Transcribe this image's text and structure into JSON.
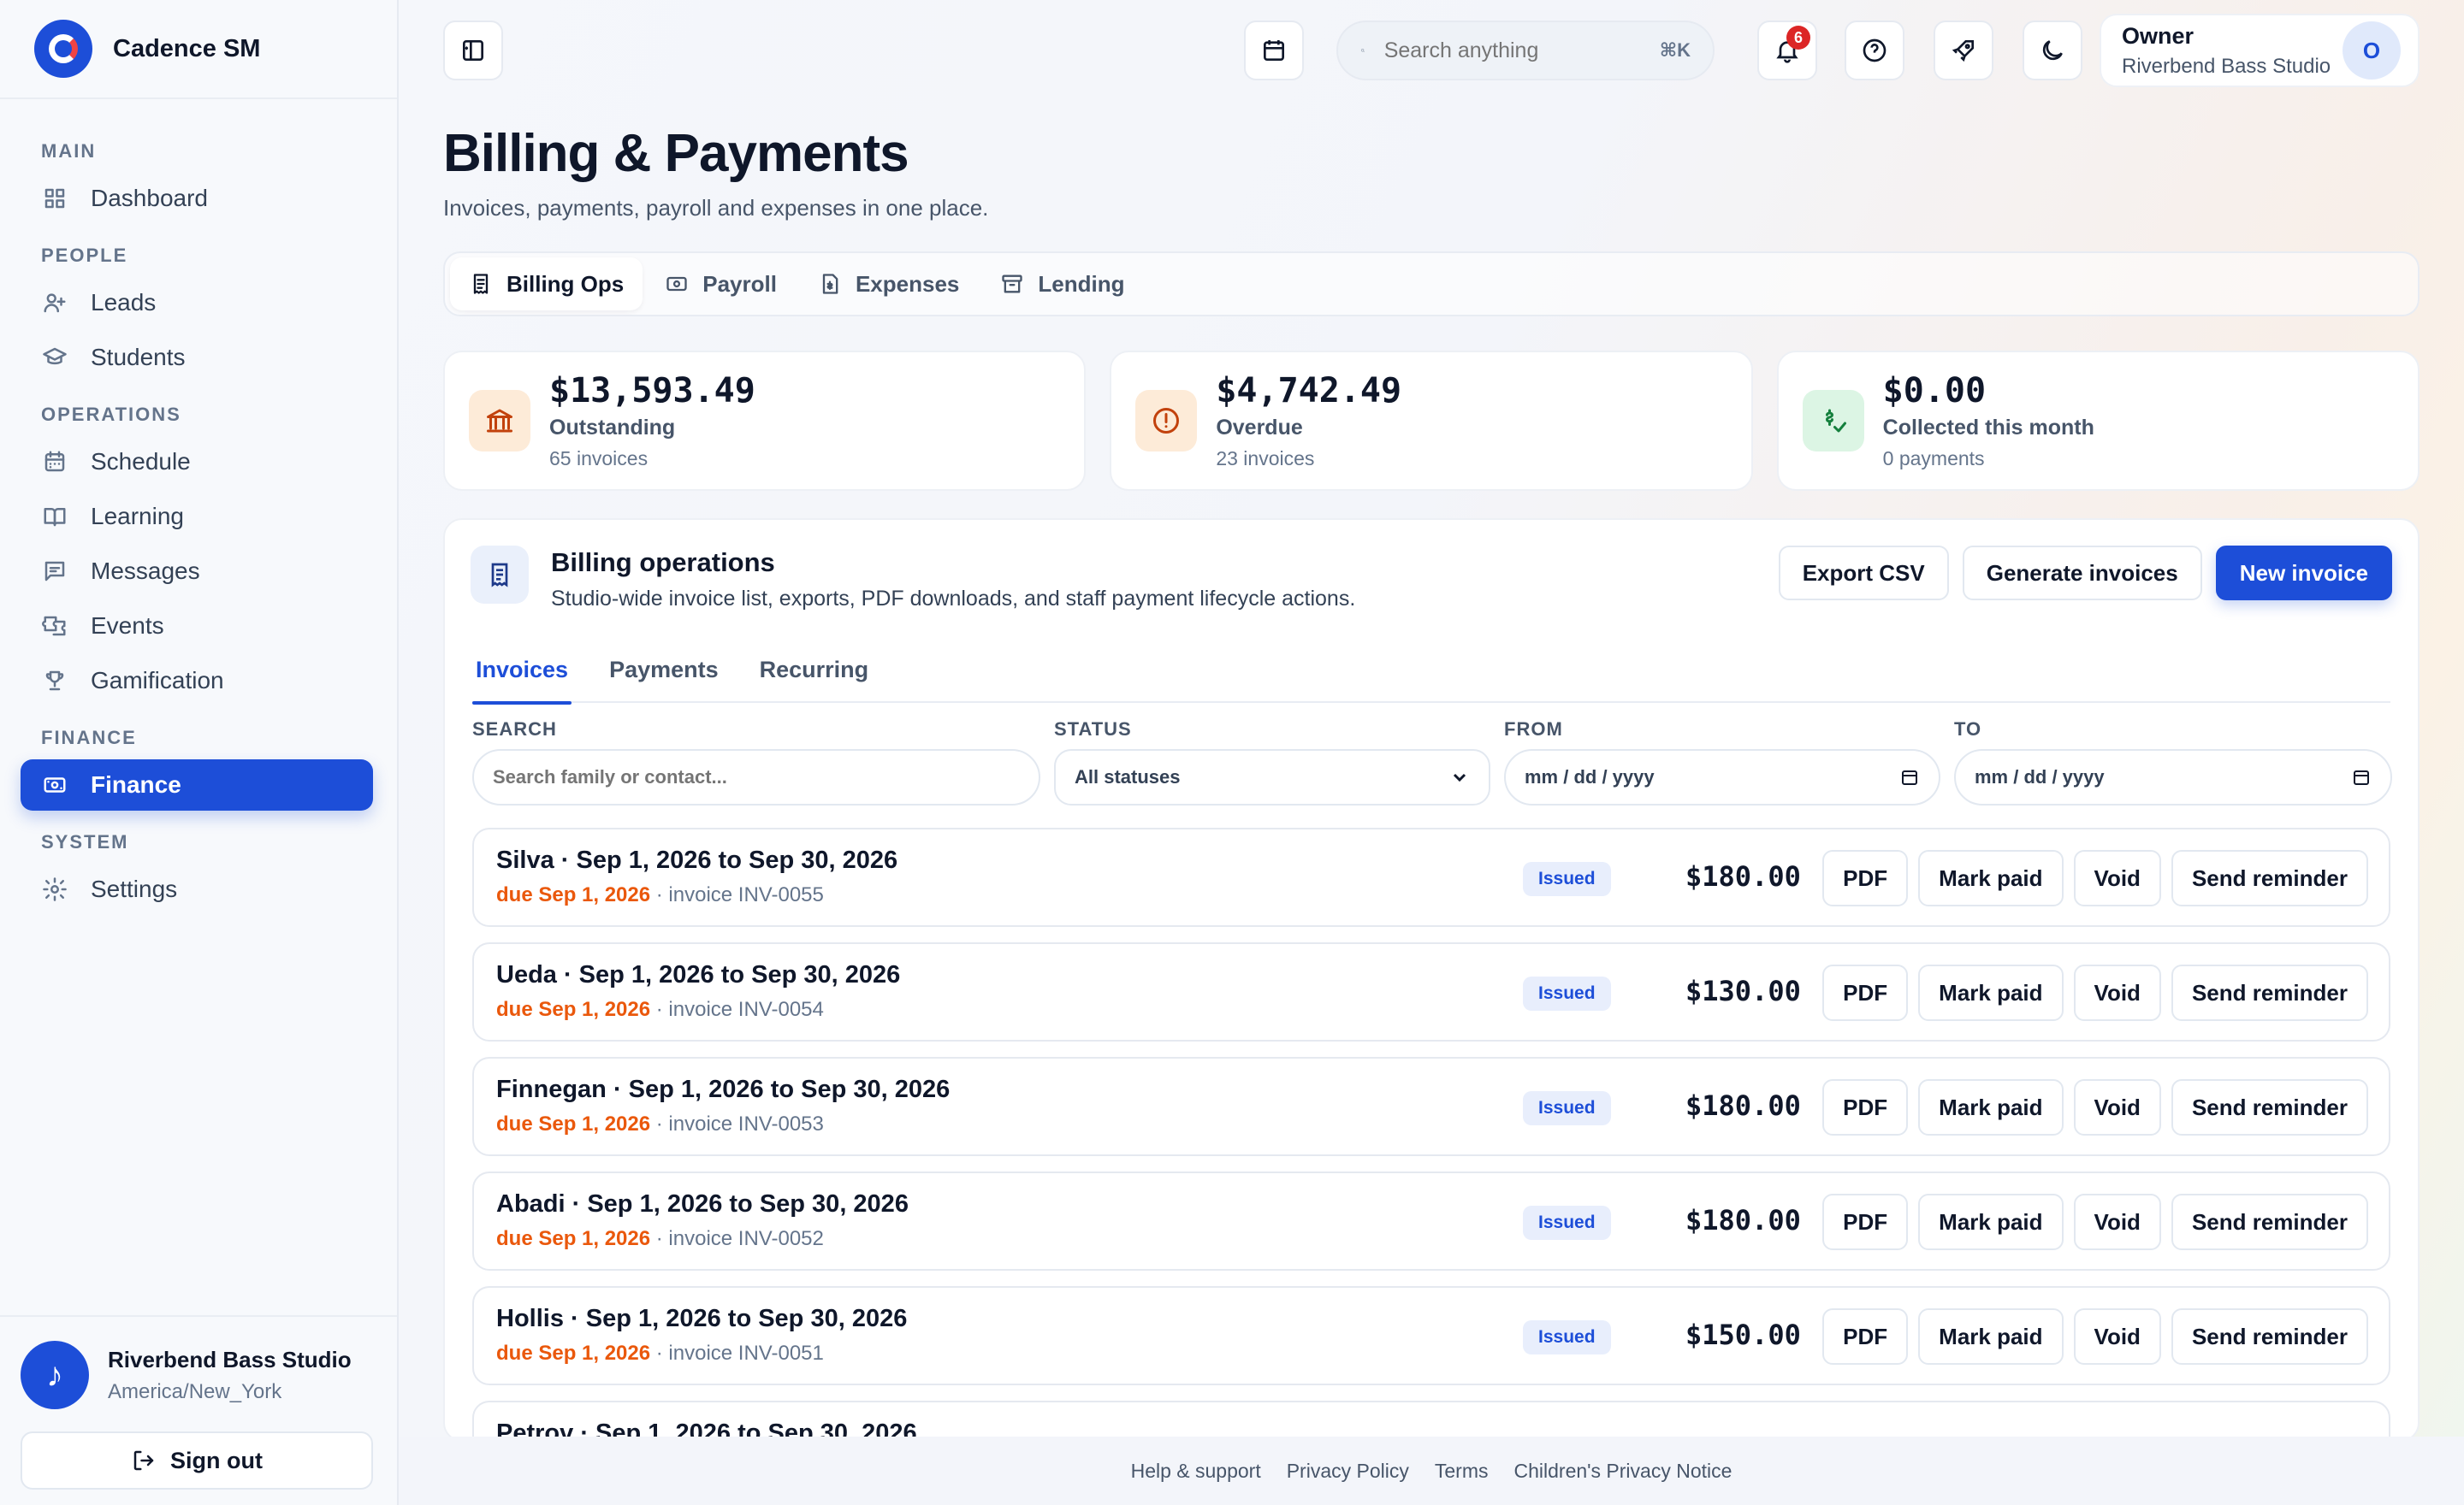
{
  "brand": {
    "name": "Cadence SM"
  },
  "sidebar": {
    "sections": [
      {
        "title": "MAIN",
        "items": [
          {
            "label": "Dashboard",
            "icon": "grid-icon"
          }
        ]
      },
      {
        "title": "PEOPLE",
        "items": [
          {
            "label": "Leads",
            "icon": "user-plus-icon"
          },
          {
            "label": "Students",
            "icon": "graduation-cap-icon"
          }
        ]
      },
      {
        "title": "OPERATIONS",
        "items": [
          {
            "label": "Schedule",
            "icon": "calendar-icon"
          },
          {
            "label": "Learning",
            "icon": "book-open-icon"
          },
          {
            "label": "Messages",
            "icon": "message-icon"
          },
          {
            "label": "Events",
            "icon": "ticket-icon"
          },
          {
            "label": "Gamification",
            "icon": "trophy-icon"
          }
        ]
      },
      {
        "title": "FINANCE",
        "items": [
          {
            "label": "Finance",
            "icon": "banknote-icon",
            "active": true
          }
        ]
      },
      {
        "title": "SYSTEM",
        "items": [
          {
            "label": "Settings",
            "icon": "gear-icon"
          }
        ]
      }
    ],
    "studio": {
      "name": "Riverbend Bass Studio",
      "timezone": "America/New_York",
      "avatar_glyph": "♪"
    },
    "signout_label": "Sign out"
  },
  "topbar": {
    "search_placeholder": "Search anything",
    "search_shortcut": "⌘K",
    "notifications_count": "6",
    "user": {
      "role": "Owner",
      "org": "Riverbend Bass Studio",
      "initial": "O"
    }
  },
  "page": {
    "title": "Billing & Payments",
    "subtitle": "Invoices, payments, payroll and expenses in one place."
  },
  "tabs": [
    {
      "label": "Billing Ops",
      "active": true
    },
    {
      "label": "Payroll"
    },
    {
      "label": "Expenses"
    },
    {
      "label": "Lending"
    }
  ],
  "kpis": [
    {
      "value": "$13,593.49",
      "label": "Outstanding",
      "sub": "65 invoices",
      "color": "#c2410c",
      "bg": "#fdebd8"
    },
    {
      "value": "$4,742.49",
      "label": "Overdue",
      "sub": "23 invoices",
      "color": "#c2410c",
      "bg": "#fdebd8"
    },
    {
      "value": "$0.00",
      "label": "Collected this month",
      "sub": "0 payments",
      "color": "#15803d",
      "bg": "#dcf5e4"
    }
  ],
  "panel": {
    "title": "Billing operations",
    "description": "Studio-wide invoice list, exports, PDF downloads, and staff payment lifecycle actions.",
    "actions": {
      "export": "Export CSV",
      "generate": "Generate invoices",
      "new": "New invoice"
    },
    "sub_tabs": [
      "Invoices",
      "Payments",
      "Recurring"
    ],
    "filters": {
      "search_label": "SEARCH",
      "search_placeholder": "Search family or contact...",
      "status_label": "STATUS",
      "status_value": "All statuses",
      "from_label": "FROM",
      "from_value": "mm / dd / yyyy",
      "to_label": "TO",
      "to_value": "mm / dd / yyyy"
    },
    "row_actions": {
      "pdf": "PDF",
      "mark_paid": "Mark paid",
      "void": "Void",
      "reminder": "Send reminder"
    },
    "invoices": [
      {
        "title": "Silva · Sep 1, 2026 to Sep 30, 2026",
        "due": "due Sep 1, 2026",
        "ref": " · invoice INV-0055",
        "status": "Issued",
        "amount": "$180.00"
      },
      {
        "title": "Ueda · Sep 1, 2026 to Sep 30, 2026",
        "due": "due Sep 1, 2026",
        "ref": " · invoice INV-0054",
        "status": "Issued",
        "amount": "$130.00"
      },
      {
        "title": "Finnegan · Sep 1, 2026 to Sep 30, 2026",
        "due": "due Sep 1, 2026",
        "ref": " · invoice INV-0053",
        "status": "Issued",
        "amount": "$180.00"
      },
      {
        "title": "Abadi · Sep 1, 2026 to Sep 30, 2026",
        "due": "due Sep 1, 2026",
        "ref": " · invoice INV-0052",
        "status": "Issued",
        "amount": "$180.00"
      },
      {
        "title": "Hollis · Sep 1, 2026 to Sep 30, 2026",
        "due": "due Sep 1, 2026",
        "ref": " · invoice INV-0051",
        "status": "Issued",
        "amount": "$150.00"
      },
      {
        "title": "Petrov · Sep 1, 2026 to Sep 30, 2026",
        "due": "",
        "ref": "",
        "status": "",
        "amount": ""
      }
    ]
  },
  "footer": {
    "links": [
      "Help & support",
      "Privacy Policy",
      "Terms",
      "Children's Privacy Notice"
    ]
  }
}
